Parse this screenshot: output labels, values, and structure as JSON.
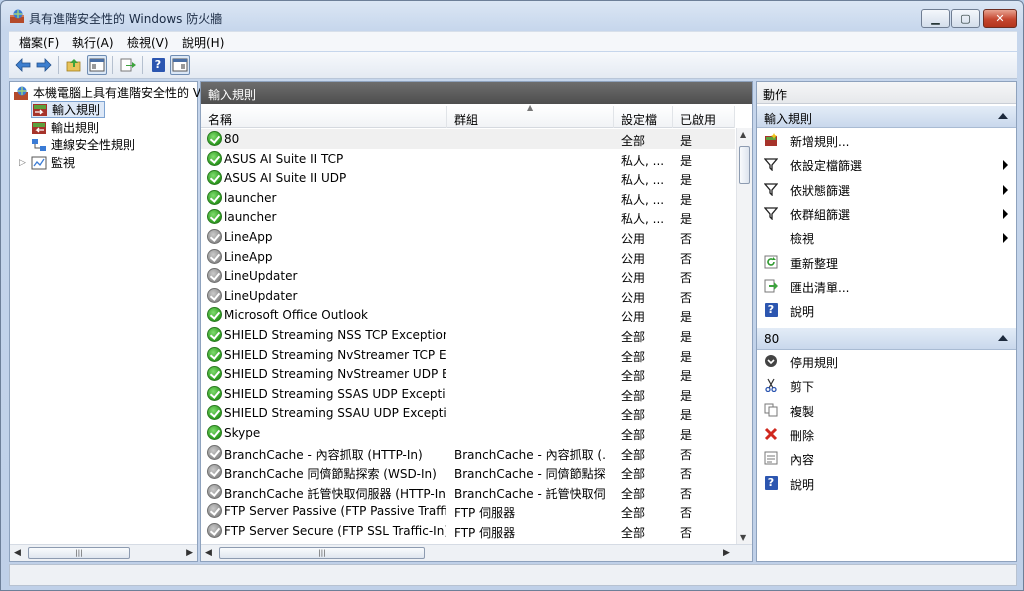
{
  "window": {
    "title": "具有進階安全性的 Windows 防火牆"
  },
  "menu": [
    "檔案(F)",
    "執行(A)",
    "檢視(V)",
    "說明(H)"
  ],
  "toolbar": [
    "back-icon",
    "forward-icon",
    "up-folder-icon",
    "show-hide-tree-icon",
    "export-icon",
    "help-icon",
    "show-hide-action-pane-icon"
  ],
  "tree": {
    "root": "本機電腦上具有進階安全性的 V",
    "items": [
      "輸入規則",
      "輸出規則",
      "連線安全性規則",
      "監視"
    ]
  },
  "center": {
    "header": "輸入規則",
    "columns": [
      "名稱",
      "群組",
      "設定檔",
      "已啟用"
    ],
    "rows": [
      {
        "name": "80",
        "group": "",
        "profile": "全部",
        "enabled": "是",
        "on": true
      },
      {
        "name": "ASUS AI Suite II TCP",
        "group": "",
        "profile": "私人, ...",
        "enabled": "是",
        "on": true
      },
      {
        "name": "ASUS AI Suite II UDP",
        "group": "",
        "profile": "私人, ...",
        "enabled": "是",
        "on": true
      },
      {
        "name": "launcher",
        "group": "",
        "profile": "私人, ...",
        "enabled": "是",
        "on": true
      },
      {
        "name": "launcher",
        "group": "",
        "profile": "私人, ...",
        "enabled": "是",
        "on": true
      },
      {
        "name": "LineApp",
        "group": "",
        "profile": "公用",
        "enabled": "否",
        "on": false
      },
      {
        "name": "LineApp",
        "group": "",
        "profile": "公用",
        "enabled": "否",
        "on": false
      },
      {
        "name": "LineUpdater",
        "group": "",
        "profile": "公用",
        "enabled": "否",
        "on": false
      },
      {
        "name": "LineUpdater",
        "group": "",
        "profile": "公用",
        "enabled": "否",
        "on": false
      },
      {
        "name": "Microsoft Office Outlook",
        "group": "",
        "profile": "公用",
        "enabled": "是",
        "on": true
      },
      {
        "name": "SHIELD Streaming NSS TCP Exception",
        "group": "",
        "profile": "全部",
        "enabled": "是",
        "on": true
      },
      {
        "name": "SHIELD Streaming NvStreamer TCP Ex...",
        "group": "",
        "profile": "全部",
        "enabled": "是",
        "on": true
      },
      {
        "name": "SHIELD Streaming NvStreamer UDP Ex...",
        "group": "",
        "profile": "全部",
        "enabled": "是",
        "on": true
      },
      {
        "name": "SHIELD Streaming SSAS UDP Exception",
        "group": "",
        "profile": "全部",
        "enabled": "是",
        "on": true
      },
      {
        "name": "SHIELD Streaming SSAU UDP Exception",
        "group": "",
        "profile": "全部",
        "enabled": "是",
        "on": true
      },
      {
        "name": "Skype",
        "group": "",
        "profile": "全部",
        "enabled": "是",
        "on": true
      },
      {
        "name": "BranchCache - 內容抓取 (HTTP-In)",
        "group": "BranchCache - 內容抓取 (...",
        "profile": "全部",
        "enabled": "否",
        "on": false
      },
      {
        "name": "BranchCache 同儕節點探索 (WSD-In)",
        "group": "BranchCache - 同儕節點探...",
        "profile": "全部",
        "enabled": "否",
        "on": false
      },
      {
        "name": "BranchCache 託管快取伺服器 (HTTP-In)",
        "group": "BranchCache - 託管快取伺...",
        "profile": "全部",
        "enabled": "否",
        "on": false
      },
      {
        "name": "FTP Server Passive (FTP Passive Traffic-I...",
        "group": "FTP 伺服器",
        "profile": "全部",
        "enabled": "否",
        "on": false
      },
      {
        "name": "FTP Server Secure (FTP SSL Traffic-In)",
        "group": "FTP 伺服器",
        "profile": "全部",
        "enabled": "否",
        "on": false
      }
    ]
  },
  "actions": {
    "header": "動作",
    "section1": {
      "title": "輸入規則",
      "items": [
        {
          "label": "新增規則...",
          "icon": "new-rule-icon",
          "submenu": false
        },
        {
          "label": "依設定檔篩選",
          "icon": "filter-icon",
          "submenu": true
        },
        {
          "label": "依狀態篩選",
          "icon": "filter-icon",
          "submenu": true
        },
        {
          "label": "依群組篩選",
          "icon": "filter-icon",
          "submenu": true
        },
        {
          "label": "檢視",
          "icon": "",
          "submenu": true
        },
        {
          "label": "重新整理",
          "icon": "refresh-icon",
          "submenu": false
        },
        {
          "label": "匯出清單...",
          "icon": "export-icon",
          "submenu": false
        },
        {
          "label": "說明",
          "icon": "help-icon",
          "submenu": false
        }
      ]
    },
    "section2": {
      "title": "80",
      "items": [
        {
          "label": "停用規則",
          "icon": "disable-rule-icon"
        },
        {
          "label": "剪下",
          "icon": "cut-icon"
        },
        {
          "label": "複製",
          "icon": "copy-icon"
        },
        {
          "label": "刪除",
          "icon": "delete-icon"
        },
        {
          "label": "內容",
          "icon": "properties-icon"
        },
        {
          "label": "說明",
          "icon": "help-icon"
        }
      ]
    }
  },
  "colors": {
    "enabled": "#2c9a1e",
    "disabled": "#8c8c8c",
    "pane_header": "#5a5a5a",
    "section_header": "#c9d8ec"
  }
}
